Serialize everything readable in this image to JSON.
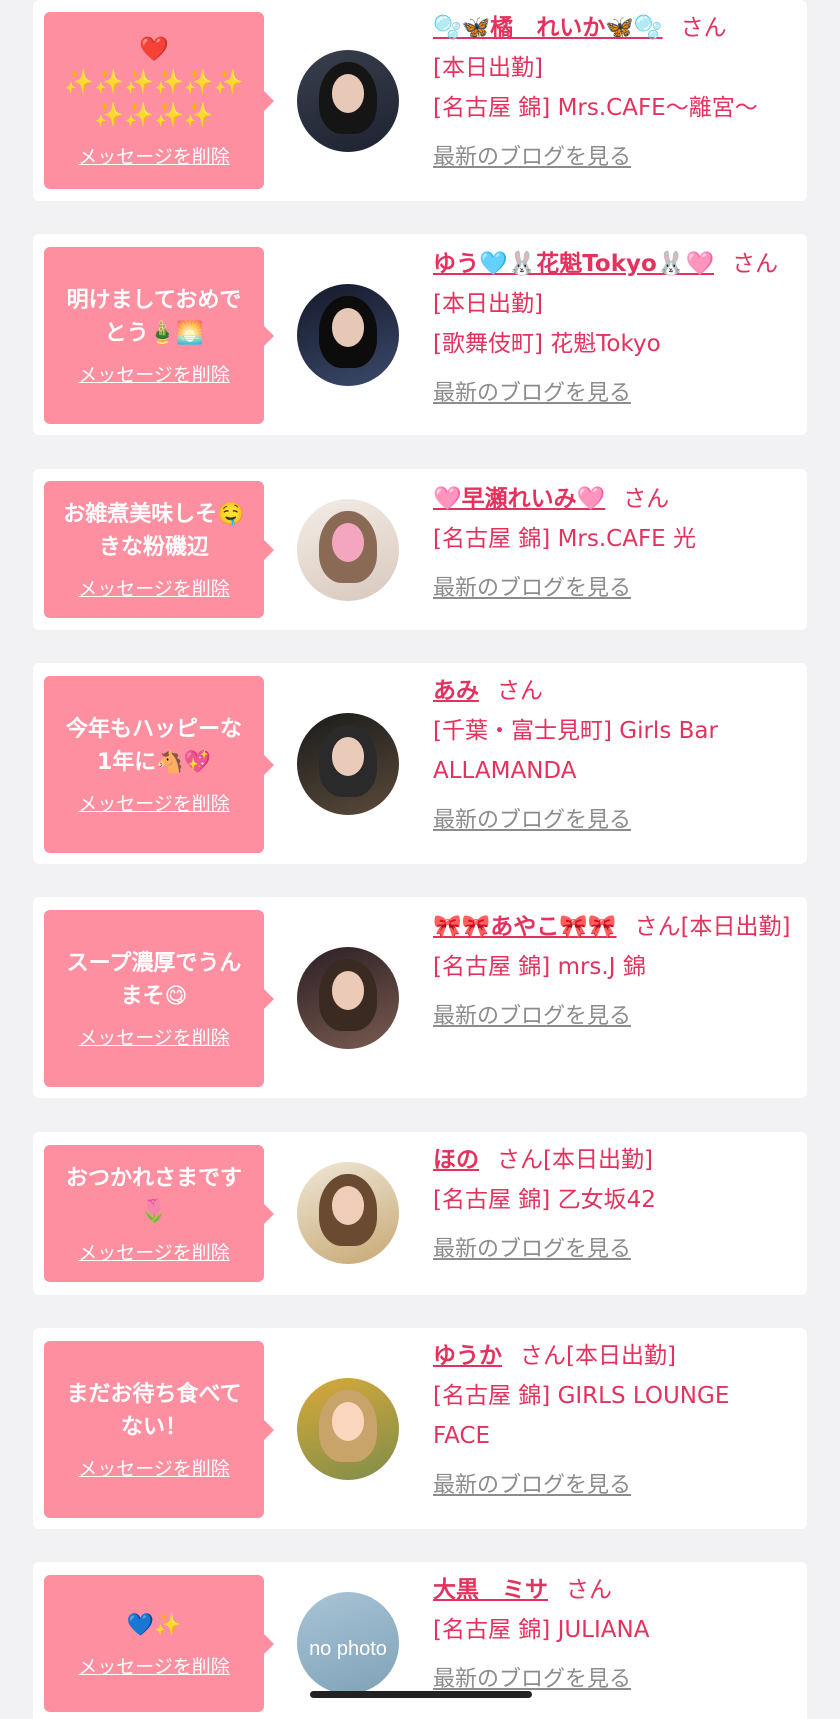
{
  "delete_label": "メッセージを削除",
  "blog_label": "最新のブログを見る",
  "san_label": "さん",
  "cards": [
    {
      "message": "❤️\n✨✨✨✨✨✨\n✨✨✨✨",
      "name": "🫧🦋橘　れいか🦋🫧",
      "after_name": "",
      "shop": "[本日出勤]\n[名古屋 錦] Mrs.CAFE〜離宮〜",
      "avatar_colors": [
        "#1d2230",
        "#3a3f4d"
      ]
    },
    {
      "message": "明けましておめで\nとう🎍🌅",
      "name": "ゆう🩵🐰花魁Tokyo🐰🩷",
      "after_name": "",
      "shop": "[本日出勤]\n[歌舞伎町] 花魁Tokyo",
      "avatar_colors": [
        "#3b4a6b",
        "#15182a"
      ]
    },
    {
      "message": "お雑煮美味しそ🤤\nきな粉磯辺",
      "name": "🩷早瀬れいみ🩷",
      "after_name": "",
      "shop": "[名古屋 錦] Mrs.CAFE 光",
      "avatar_colors": [
        "#e9ddd5",
        "#f4a6c0"
      ]
    },
    {
      "message": "今年もハッピーな\n1年に🐴💖",
      "name": "あみ",
      "after_name": "",
      "shop": "[千葉・富士見町] Girls Bar ALLAMANDA",
      "avatar_colors": [
        "#1b1b1b",
        "#5a4a3a"
      ]
    },
    {
      "message": "スープ濃厚でうん\nまそ😋",
      "name": "🎀🎀あやこ🎀🎀",
      "after_name": "[本日出勤]",
      "shop": "[名古屋 錦] mrs.J 錦",
      "avatar_colors": [
        "#2b2025",
        "#7a5a50"
      ]
    },
    {
      "message": "おつかれさまです\n🌷",
      "name": "ほの",
      "after_name": "[本日出勤]",
      "shop": "[名古屋 錦] 乙女坂42",
      "avatar_colors": [
        "#efe7d6",
        "#c7a874"
      ]
    },
    {
      "message": "まだお待ち食べて\nない！",
      "name": "ゆうか",
      "after_name": "[本日出勤]",
      "shop": "[名古屋 錦] GIRLS LOUNGE FACE",
      "avatar_colors": [
        "#d8a93a",
        "#7e8d4a"
      ]
    },
    {
      "message": "💙✨",
      "name": "大黒　ミサ",
      "after_name": "",
      "shop": "[名古屋 錦] JULIANA",
      "avatar_colors": [
        "#a9c4d6",
        "#7fa2b8"
      ],
      "avatar_text": "no photo"
    }
  ]
}
